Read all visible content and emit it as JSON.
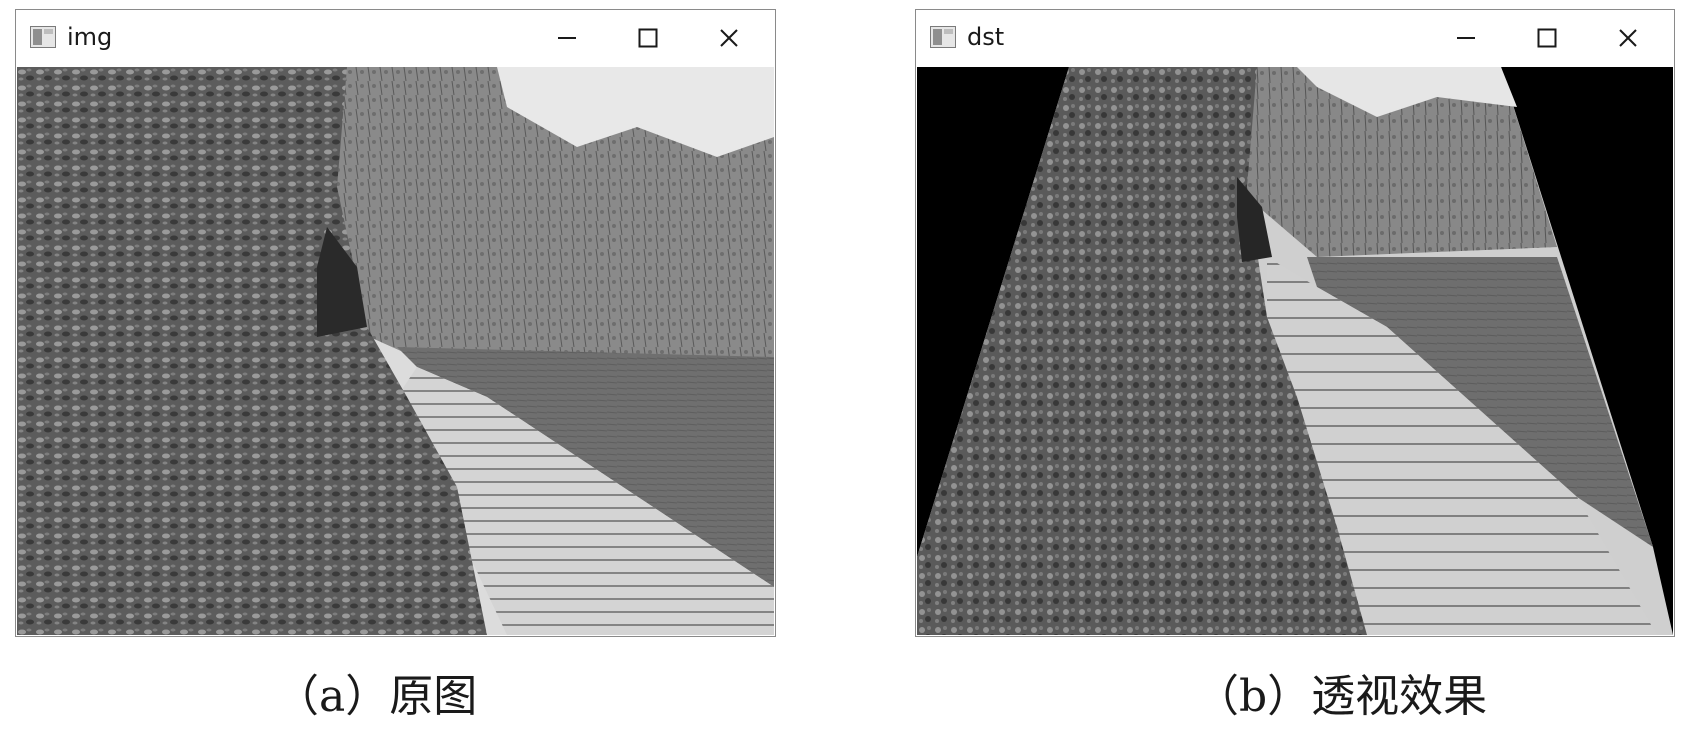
{
  "windows": {
    "original": {
      "title": "img"
    },
    "transformed": {
      "title": "dst"
    }
  },
  "window_controls": {
    "minimize_icon": "minimize-icon",
    "maximize_icon": "maximize-icon",
    "close_icon": "close-icon"
  },
  "captions": {
    "a": "（a）原图",
    "b": "（b）透视效果"
  },
  "colors": {
    "background": "#ffffff",
    "window_border": "#8a8a8a",
    "photo_tone": "grayscale",
    "dst_fill": "#000000"
  }
}
